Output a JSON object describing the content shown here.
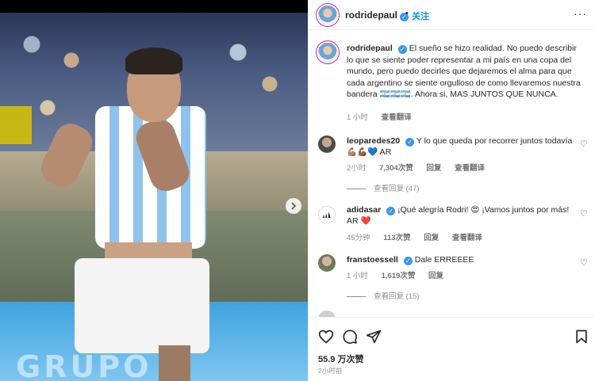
{
  "post": {
    "username": "rodridepaul",
    "follow_label": "关注",
    "more_label": "···"
  },
  "caption": {
    "username": "rodridepaul",
    "text": "El sueño se hizo realidad. No puedo describir lo que se siente poder representar a mi país en una copa del mundo, pero puedo decirles que dejaremos el alma para que cada argentino se siente orgulloso de como llevaremos nuestra bandera 🇦🇷🇦🇷🇦🇷. Ahora si, MAS JUNTOS QUE NUNCA.",
    "time": "1 小时",
    "translate": "查看翻译"
  },
  "comments": [
    {
      "username": "leoparedes20",
      "text": "Y lo que queda por recorrer juntos todavía 💪🏽💪🏾💙 AR",
      "time": "2小时",
      "likes": "7,304次赞",
      "reply": "回复",
      "translate": "查看翻译",
      "view_replies": "查看回复 (47)"
    },
    {
      "username": "adidasar",
      "text": "¡Qué alegría Rodri! 😍 ¡Vamos juntos por más! AR ❤️",
      "time": "45分钟",
      "likes": "113次赞",
      "reply": "回复",
      "translate": "查看翻译"
    },
    {
      "username": "franstoessell",
      "text": "Dale ERREEEE",
      "time": "1 小时",
      "likes": "1,619次赞",
      "reply": "回复",
      "view_replies": "查看回复 (15)"
    }
  ],
  "footer": {
    "likes": "55.9 万次赞",
    "time": "2小时前"
  },
  "media": {
    "board_text": "GRUPO"
  },
  "icons": {
    "like": "heart-icon",
    "comment": "comment-icon",
    "share": "send-icon",
    "save": "bookmark-icon",
    "next": "chevron-right-icon"
  }
}
